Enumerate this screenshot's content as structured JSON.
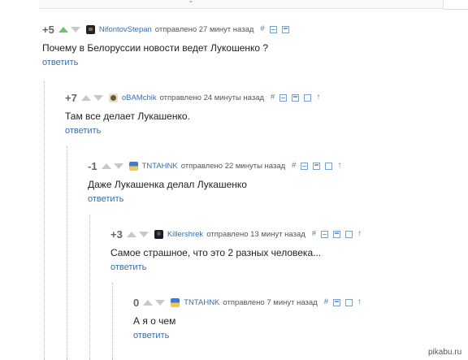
{
  "comments": [
    {
      "rating": "+5",
      "nick": "NifontovStepan",
      "sent": "отправлено",
      "time": "27 минут назад",
      "hash": "#",
      "up": "↑",
      "text": "Почему в Белоруссии новости ведет Лукошенко ?",
      "reply": "ответить"
    },
    {
      "rating": "+7",
      "nick": "oBAMchik",
      "sent": "отправлено",
      "time": "24 минуты назад",
      "hash": "#",
      "up": "↑",
      "text": "Там все делает Лукашенко.",
      "reply": "ответить"
    },
    {
      "rating": "-1",
      "nick": "TNTAHNK",
      "sent": "отправлено",
      "time": "22 минуты назад",
      "hash": "#",
      "up": "↑",
      "text": "Даже Лукашенка делал Лукашенко",
      "reply": "ответить"
    },
    {
      "rating": "+3",
      "nick": "Killershrek",
      "sent": "отправлено",
      "time": "13 минут назад",
      "hash": "#",
      "up": "↑",
      "text": "Самое страшное, что это 2 разных человека...",
      "reply": "ответить"
    },
    {
      "rating": "0",
      "nick": "TNTAHNK",
      "sent": "отправлено",
      "time": "7 минут назад",
      "hash": "#",
      "up": "↑",
      "text": "А я о чем",
      "reply": "ответить"
    }
  ],
  "watermark": "pikabu.ru"
}
